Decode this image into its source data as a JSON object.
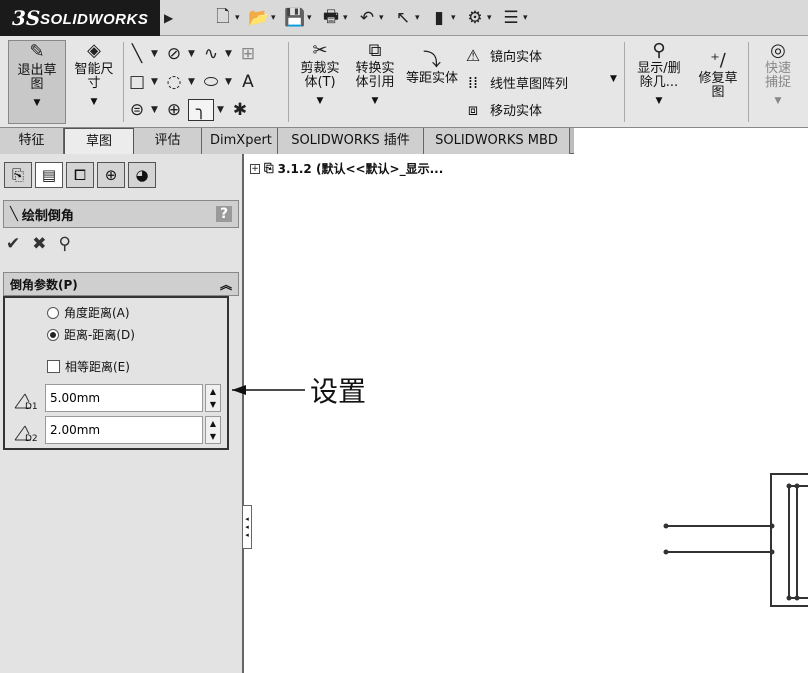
{
  "app": {
    "logo_ds": "3S",
    "logo_text": "SOLIDWORKS"
  },
  "quick_access": [
    {
      "icon": "new-document-icon",
      "glyph": "🗋"
    },
    {
      "icon": "open-folder-icon",
      "glyph": "📂"
    },
    {
      "icon": "save-icon",
      "glyph": "💾"
    },
    {
      "icon": "print-icon",
      "glyph": "🖶"
    },
    {
      "icon": "undo-icon",
      "glyph": "↶"
    },
    {
      "icon": "select-cursor-icon",
      "glyph": "↖"
    },
    {
      "icon": "traffic-light-icon",
      "glyph": "▮"
    },
    {
      "icon": "options-icon",
      "glyph": "⚙"
    },
    {
      "icon": "list-options-icon",
      "glyph": "☰"
    }
  ],
  "ribbon": {
    "exit_sketch": "退出草图",
    "smart_dim": "智能尺寸",
    "trim": "剪裁实体(T)",
    "convert": "转换实体引用",
    "offset": "等距实体",
    "mirror": "镜向实体",
    "linear_pattern": "线性草图阵列",
    "move": "移动实体",
    "display_delete": "显示/删除几...",
    "repair": "修复草图",
    "rapid_snap": "快速捕捉"
  },
  "tabs": [
    "特征",
    "草图",
    "评估",
    "DimXpert",
    "SOLIDWORKS 插件",
    "SOLIDWORKS MBD"
  ],
  "active_tab": "草图",
  "property_manager": {
    "title": "绘制倒角",
    "help": "?",
    "group_title": "倒角参数(P)",
    "options": {
      "angle_distance": "角度距离(A)",
      "distance_distance": "距离-距离(D)",
      "equal_distance": "相等距离(E)"
    },
    "selected_option": "distance_distance",
    "equal_checked": false,
    "d1_label": "D1",
    "d2_label": "D2",
    "d1_value": "5.00mm",
    "d2_value": "2.00mm"
  },
  "tree": {
    "item": "3.1.2 (默认<<默认>_显示..."
  },
  "annotation": "设置"
}
